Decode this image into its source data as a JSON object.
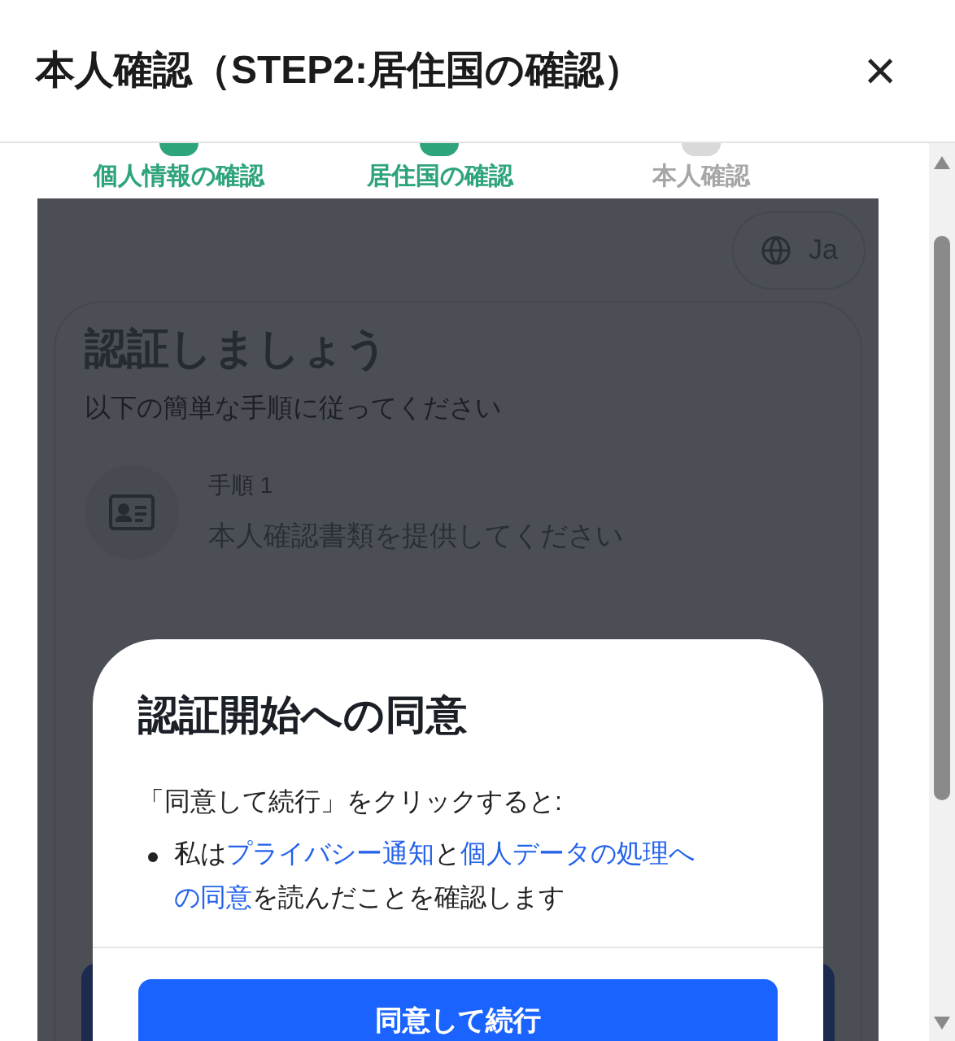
{
  "header": {
    "title": "本人確認（STEP2:居住国の確認）",
    "close": "×"
  },
  "steps": [
    {
      "label": "個人情報の確認",
      "completed": true
    },
    {
      "label": "居住国の確認",
      "completed": true
    },
    {
      "label": "本人確認",
      "completed": false
    }
  ],
  "verification": {
    "language": "Ja",
    "heading": "認証しましょう",
    "subtitle": "以下の簡単な手順に従ってください",
    "step": {
      "number": "手順 1",
      "text": "本人確認書類を提供してください"
    }
  },
  "consent_dialog": {
    "title": "認証開始への同意",
    "intro": "「同意して続行」をクリックすると:",
    "bullets": [
      [
        {
          "kind": "text",
          "text": "私は"
        },
        {
          "kind": "link",
          "text": "プライバシー通知"
        },
        {
          "kind": "text",
          "text": "と"
        },
        {
          "kind": "link",
          "text": "個人データの処理へ"
        },
        {
          "kind": "link",
          "text": "の同意"
        },
        {
          "kind": "text",
          "text": "を読んだことを確認します"
        }
      ]
    ],
    "button": "同意して続行"
  }
}
